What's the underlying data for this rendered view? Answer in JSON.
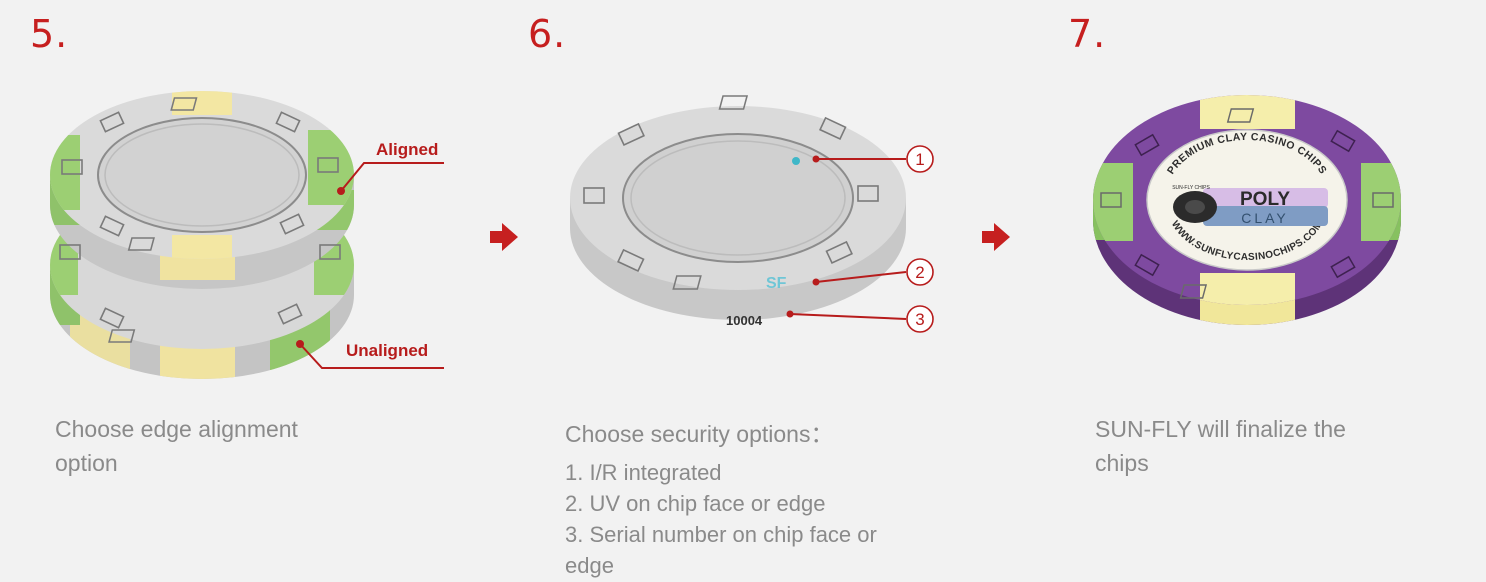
{
  "steps": [
    {
      "number": "5.",
      "description": "Choose edge alignment option",
      "callouts": {
        "aligned": "Aligned",
        "unaligned": "Unaligned"
      }
    },
    {
      "number": "6.",
      "description": "Choose security options：",
      "chip_marks": {
        "uv_logo": "SF",
        "serial": "10004"
      },
      "callout_numbers": [
        "1",
        "2",
        "3"
      ],
      "options": [
        "1. I/R integrated",
        "2. UV on chip face or edge",
        "3. Serial number on chip face or",
        "edge"
      ]
    },
    {
      "number": "7.",
      "description": "SUN-FLY will finalize the chips",
      "chip_label": {
        "top_arc": "PREMIUM CLAY CASINO CHIPS",
        "bottom_arc": "WWW.SUNFLYCASINOCHIPS.COM",
        "brand_line1": "POLY",
        "brand_line2": "CLAY",
        "small_text": "SUN-FLY CHIPS"
      }
    }
  ],
  "colors": {
    "step_number": "#c61f1f",
    "callout_line": "#b71c1c",
    "chip_grey": "#d8d8d8",
    "edge_green": "#9ccf73",
    "edge_yellow": "#f3e7a3",
    "chip_purple": "#7e4aa0",
    "uv_cyan": "#3fb7c8"
  },
  "icons": [
    "arrow-right-icon"
  ]
}
